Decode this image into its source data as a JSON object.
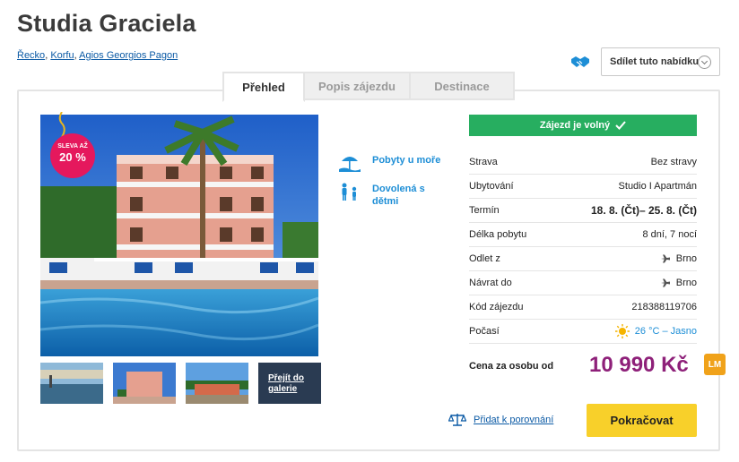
{
  "hotel": {
    "name": "Studia Graciela"
  },
  "breadcrumb": {
    "items": [
      "Řecko",
      "Korfu",
      "Agios Georgios Pagon"
    ]
  },
  "share": {
    "label": "Sdílet tuto nabídku"
  },
  "tabs": [
    {
      "label": "Přehled",
      "active": true
    },
    {
      "label": "Popis zájezdu",
      "active": false
    },
    {
      "label": "Destinace",
      "active": false
    }
  ],
  "photo": {
    "badge_top": "SLEVA AŽ",
    "badge_value": "20 %"
  },
  "gallery": {
    "link_label": "Přejít do galerie"
  },
  "features": [
    {
      "label": "Pobyty u moře",
      "icon": "beach-umbrella-icon"
    },
    {
      "label": "Dovolená s dětmi",
      "icon": "family-icon"
    }
  ],
  "status": {
    "label": "Zájezd je volný",
    "color": "#27ae60"
  },
  "info": {
    "rows": [
      {
        "label": "Strava",
        "value": "Bez stravy"
      },
      {
        "label": "Ubytování",
        "value": "Studio I Apartmán"
      },
      {
        "label": "Termín",
        "value": "18. 8. (Čt)– 25. 8. (Čt)"
      },
      {
        "label": "Délka pobytu",
        "value": "8 dní, 7 nocí"
      },
      {
        "label": "Odlet z",
        "value": "Brno"
      },
      {
        "label": "Návrat do",
        "value": "Brno"
      },
      {
        "label": "Kód zájezdu",
        "value": "218388119706"
      },
      {
        "label": "Počasí",
        "value": "26 °C – Jasno"
      }
    ]
  },
  "price": {
    "label": "Cena za osobu od",
    "value": "10 990 Kč",
    "badge": "LM",
    "color": "#8e2079"
  },
  "actions": {
    "compare_label": "Přidat k porovnání",
    "continue_label": "Pokračovat"
  }
}
